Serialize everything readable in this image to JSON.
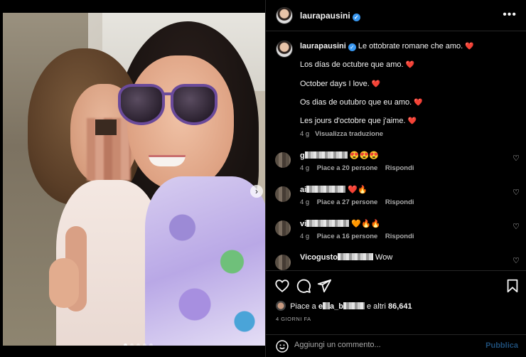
{
  "post": {
    "dots": 5,
    "active_dot": 0
  },
  "header": {
    "username": "laurapausini",
    "verified": "✓",
    "more": "•••"
  },
  "caption": {
    "username": "laurapausini",
    "line1": "Le ottobrate romane che amo.",
    "line2": "Los días de octubre que amo.",
    "line3": "October days I love.",
    "line4": "Os dias de outubro que eu amo.",
    "line5": "Les jours d'octobre que j'aime.",
    "heart": "❤️",
    "time": "4 g",
    "translate": "Visualizza traduzione"
  },
  "comments": [
    {
      "name_start": "g",
      "text": "😍😍😍",
      "time": "4 g",
      "likes": "Piace a 20 persone",
      "reply": "Rispondi"
    },
    {
      "name_start": "ai",
      "text": "❤️🔥",
      "time": "4 g",
      "likes": "Piace a 27 persone",
      "reply": "Rispondi"
    },
    {
      "name_start": "vi",
      "text": "🧡🔥🔥",
      "time": "4 g",
      "likes": "Piace a 16 persone",
      "reply": "Rispondi"
    },
    {
      "name_start": "Vicogusto",
      "text": "Wow",
      "time": "",
      "likes": "",
      "reply": ""
    }
  ],
  "likes": {
    "prefix": "Piace a",
    "user_start": "e",
    "user_mid": "a_b",
    "suffix": "e altri",
    "count": "86,641"
  },
  "time_ago": "4 GIORNI FA",
  "add_comment": {
    "placeholder": "Aggiungi un commento...",
    "publish": "Pubblica"
  }
}
